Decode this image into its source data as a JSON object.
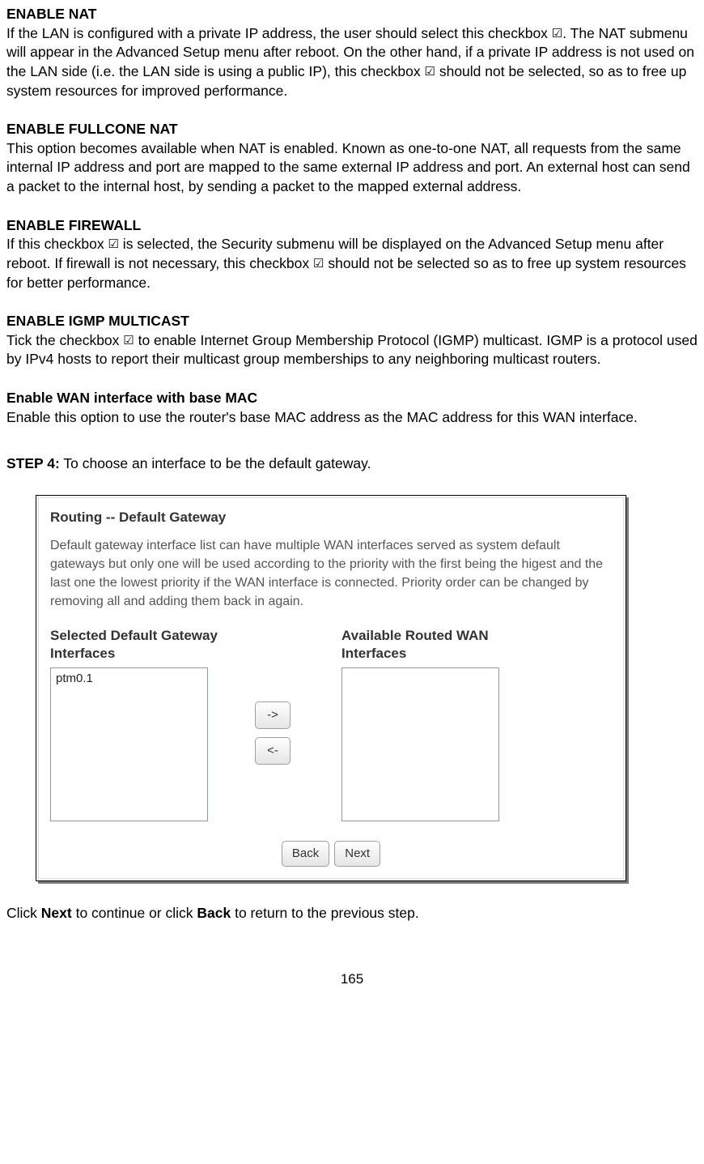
{
  "sections": {
    "nat": {
      "heading": "ENABLE NAT",
      "body_a": "If the LAN is configured with a private IP address, the user should select this checkbox ",
      "body_b": ".   The NAT submenu will appear in the Advanced Setup menu after reboot.   On the other hand, if a private IP address is not used on the LAN side (i.e. the LAN side is using a public IP), this checkbox ",
      "body_c": " should not be selected, so as to free up system resources for improved performance."
    },
    "fullcone": {
      "heading": "ENABLE FULLCONE NAT",
      "body": "This option becomes available when NAT is enabled. Known as one-to-one NAT, all requests from the same internal IP address and port are mapped to the same external IP address and port. An external host can send a packet to the internal host, by sending a packet to the mapped external address."
    },
    "firewall": {
      "heading": "ENABLE FIREWALL",
      "body_a": "If this checkbox ",
      "body_b": " is selected, the Security submenu will be displayed on the Advanced Setup menu after reboot.   If firewall is not necessary, this checkbox ",
      "body_c": " should not be selected so as to free up system resources for better performance."
    },
    "igmp": {
      "heading": "ENABLE IGMP MULTICAST",
      "body_a": "Tick the checkbox ",
      "body_b": " to enable Internet Group Membership Protocol (IGMP) multicast.   IGMP is a protocol used by IPv4 hosts to report their multicast group memberships to any neighboring multicast routers."
    },
    "basemac": {
      "heading": "Enable WAN interface with base MAC",
      "body": "Enable this option to use the router's base MAC address as the MAC address for this WAN interface."
    }
  },
  "step4": {
    "label": "STEP 4:",
    "text": " To choose an interface to be the default gateway."
  },
  "panel": {
    "title": "Routing -- Default Gateway",
    "description": "Default gateway interface list can have multiple WAN interfaces served as system default gateways but only one will be used according to the priority with the first being the higest and the last one the lowest priority if the WAN interface is connected. Priority order can be changed by removing all and adding them back in again.",
    "left_heading": "Selected Default Gateway Interfaces",
    "right_heading": "Available Routed WAN Interfaces",
    "selected_items": [
      "ptm0.1"
    ],
    "btn_right": "->",
    "btn_left": "<-",
    "btn_back": "Back",
    "btn_next": "Next"
  },
  "footer_line": {
    "a": "Click ",
    "next": "Next",
    "b": " to continue or click ",
    "back": "Back",
    "c": " to return to the previous step."
  },
  "checkbox_glyph": "☑",
  "page_number": "165"
}
